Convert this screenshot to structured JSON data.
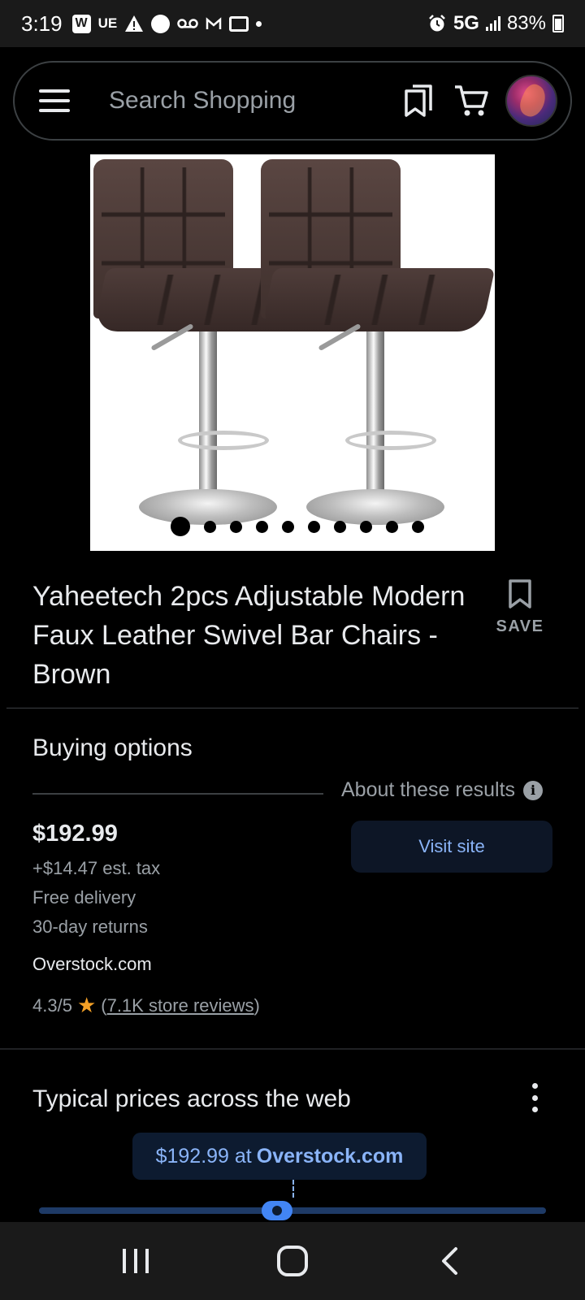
{
  "status_bar": {
    "time": "3:19",
    "network": "5G",
    "battery": "83%",
    "notif_ue": "UE"
  },
  "search": {
    "placeholder": "Search Shopping"
  },
  "product": {
    "title": "Yaheetech 2pcs Adjustable Modern Faux Leather Swivel Bar Chairs - Brown",
    "save_label": "SAVE",
    "image_dot_count": 10,
    "active_image_index": 0
  },
  "buying_options": {
    "heading": "Buying options",
    "about_results": "About these results",
    "price": "$192.99",
    "tax": "+$14.47 est. tax",
    "delivery": "Free delivery",
    "returns": "30-day returns",
    "merchant": "Overstock.com",
    "rating": "4.3/5",
    "reviews_open": "(",
    "reviews": "7.1K store reviews",
    "reviews_close": ")",
    "visit_label": "Visit site"
  },
  "typical_prices": {
    "heading": "Typical prices across the web",
    "callout_price": "$192.99 at",
    "callout_merchant": "Overstock.com",
    "marker_position_fraction": 0.47
  },
  "colors": {
    "accent_blue": "#8ab4f8",
    "star": "#f4a026",
    "background": "#000000"
  }
}
